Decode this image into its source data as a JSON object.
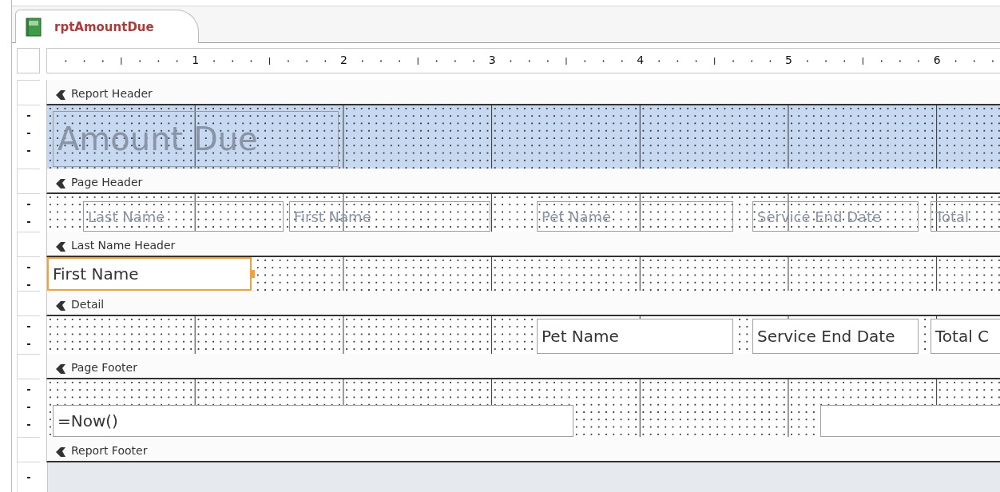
{
  "tab": {
    "title": "rptAmountDue"
  },
  "ruler": {
    "numbers": [
      "1",
      "2",
      "3",
      "4",
      "5",
      "6"
    ]
  },
  "sections": [
    {
      "title": "Report Header",
      "color": "#c6d9f0",
      "controls": [
        {
          "kind": "label",
          "text": "Amount Due",
          "selected": false
        }
      ]
    },
    {
      "title": "Page Header",
      "color": "#ffffff",
      "controls": [
        {
          "kind": "label",
          "text": "Last Name",
          "selected": false
        },
        {
          "kind": "label",
          "text": "First Name",
          "selected": false
        },
        {
          "kind": "label",
          "text": "Pet Name",
          "selected": false
        },
        {
          "kind": "label",
          "text": "Service End Date",
          "selected": false
        },
        {
          "kind": "label",
          "text": "Total",
          "selected": false
        }
      ]
    },
    {
      "title": "Last Name Header",
      "color": "#ffffff",
      "controls": [
        {
          "kind": "textbox",
          "text": "First Name",
          "selected": true
        }
      ]
    },
    {
      "title": "Detail",
      "color": "#ffffff",
      "controls": [
        {
          "kind": "textbox",
          "text": "Pet Name",
          "selected": false
        },
        {
          "kind": "textbox",
          "text": "Service End Date",
          "selected": false
        },
        {
          "kind": "textbox",
          "text": "Total C",
          "selected": false
        }
      ]
    },
    {
      "title": "Page Footer",
      "color": "#ffffff",
      "controls": [
        {
          "kind": "textbox",
          "text": "=Now()",
          "selected": false
        },
        {
          "kind": "textbox",
          "selected": false
        }
      ]
    },
    {
      "title": "Report Footer"
    }
  ]
}
